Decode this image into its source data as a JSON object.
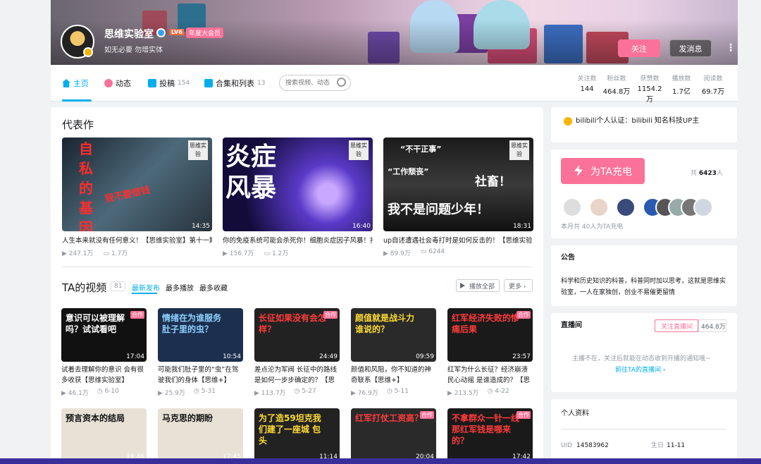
{
  "profile": {
    "name": "思维实验室",
    "level": "LV6",
    "vip_label": "年度大会员",
    "signature": "如无必要 勿增实体",
    "follow_label": "关注",
    "message_label": "发消息",
    "more": "⋮"
  },
  "nav": {
    "home": "主页",
    "dynamic": "动态",
    "posts": "投稿",
    "posts_count": "154",
    "collections": "合集和列表",
    "collections_count": "13",
    "search_placeholder": "搜索视频、动态"
  },
  "stats": [
    {
      "label": "关注数",
      "value": "144"
    },
    {
      "label": "粉丝数",
      "value": "464.8万"
    },
    {
      "label": "获赞数",
      "value": "1154.2万"
    },
    {
      "label": "播放数",
      "value": "1.7亿"
    },
    {
      "label": "阅读数",
      "value": "69.7万"
    }
  ],
  "masterpiece": {
    "title": "代表作",
    "videos": [
      {
        "thumb_text": "自私的基因",
        "overlay": "我不要借钱",
        "duration": "14:35",
        "title": "人生本来就没有任何意义！【思维实验室】第十一期",
        "plays": "247.1万",
        "danmaku": "1.7万",
        "badge": "思维实验"
      },
      {
        "thumb_text": "炎症风暴",
        "duration": "16:40",
        "title": "你的免疫系统可能会杀死你！细胞炎症因子风暴！托",
        "plays": "156.7万",
        "danmaku": "1.2万",
        "badge": "思维实验"
      },
      {
        "thumb_text": "我不是问题少年！",
        "top1": "“不干正事”",
        "top2": "“工作颓丧”",
        "right": "社畜！",
        "duration": "18:31",
        "title": "up自述遭遇社会毒打时是如何反击的！【思维实验",
        "plays": "89.9万",
        "danmaku": "6244",
        "badge": "思维实验"
      }
    ]
  },
  "ta_videos": {
    "title": "TA的视频",
    "count": "81",
    "tab_latest": "最新发布",
    "tab_most_play": "最多播放",
    "tab_most_fav": "最多收藏",
    "play_all": "播放全部",
    "more": "更多",
    "row1": [
      {
        "thumb_text": "意识可以被理解吗？试试看吧",
        "tag": "合作",
        "duration": "17:04",
        "title": "试着去理解你的意识 会有很多收获【思维实验室】",
        "plays": "46.1万",
        "date": "6-10"
      },
      {
        "thumb_text": "情绪在为谁服务 肚子里的虫？",
        "tag": "",
        "duration": "10:54",
        "title": "可能我们肚子里的“虫”在驾驶我们的身体【思维+】",
        "plays": "25.9万",
        "date": "5-31"
      },
      {
        "thumb_text": "长征如果没有会怎样？",
        "tag": "合作",
        "duration": "24:49",
        "title": "差点沦为军阀 长征中的路线是如何一步步确定的？【思维实",
        "plays": "113.7万",
        "date": "5-27"
      },
      {
        "thumb_text": "颜值就是战斗力 谁说的？",
        "tag": "",
        "duration": "09:59",
        "title": "颜值和风阻，你不知道的神奇联系【思维+】",
        "plays": "76.9万",
        "date": "5-11"
      },
      {
        "thumb_text": "红军经济失败的惨痛后果",
        "tag": "合作",
        "duration": "23:57",
        "title": "红军为什么长征？经济崩溃 民心动摇 是谁造成的？【思维实",
        "plays": "213.5万",
        "date": "4-22"
      }
    ],
    "row2": [
      {
        "thumb_text": "预言资本的结局",
        "duration": "18:46"
      },
      {
        "thumb_text": "马克思的期盼",
        "duration": "17:45"
      },
      {
        "thumb_text": "为了造59坦克我们建了一座城 包头",
        "duration": "11:14"
      },
      {
        "thumb_text": "红军打仗工资高？",
        "tag": "合作",
        "duration": "20:04"
      },
      {
        "thumb_text": "不拿群众一针一线那红军钱是哪来的？",
        "tag": "合作",
        "duration": "17:42"
      }
    ]
  },
  "sidebar": {
    "cert": "bilibili个人认证：bilibili 知名科技UP主",
    "charge_label": "为TA充电",
    "charge_total_prefix": "共",
    "charge_total": "6423",
    "charge_total_suffix": "人",
    "charge_month": "本月共 40人为TA充电",
    "notice_title": "公告",
    "notice_text": "科学和历史知识的科普，科普同时加以思考，这就是思维实验室，一人在家独创，创业不易催更留情",
    "live_title": "直播间",
    "live_follow": "关注直播间",
    "live_count": "464.8万",
    "live_status": "主播不在，关注后就能在动态收到开播的通知哦~",
    "live_link": "前往TA的直播间",
    "profile_title": "个人资料",
    "uid_label": "UID",
    "uid": "14583962",
    "birthday_label": "生日",
    "birthday": "11-11"
  },
  "colors": {
    "accent": "#00aeec",
    "pink": "#fb7299"
  }
}
